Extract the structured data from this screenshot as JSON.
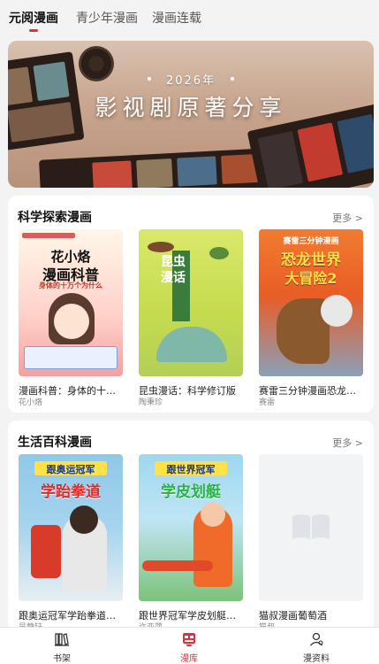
{
  "tabs": [
    {
      "label": "元阅漫画",
      "active": true
    },
    {
      "label": "青少年漫画",
      "active": false
    },
    {
      "label": "漫画连载",
      "active": false
    }
  ],
  "banner": {
    "year": "2026年",
    "title": "影视剧原著分享"
  },
  "sections": [
    {
      "title": "科学探索漫画",
      "more": "更多 >",
      "books": [
        {
          "title": "漫画科普：身体的十万个为什么",
          "author": "花小烙",
          "cover_heading": "花小烙",
          "cover_line1": "漫画科普",
          "cover_line2": "身体的十万个为什么"
        },
        {
          "title": "昆虫漫话：科学修订版",
          "author": "陶秉珍",
          "cover_heading": "昆虫漫话"
        },
        {
          "title": "赛雷三分钟漫画恐龙世界大冒险",
          "author": "赛雷",
          "cover_heading": "赛雷三分钟漫画",
          "cover_line1": "恐龙世界",
          "cover_line2": "大冒险2"
        }
      ]
    },
    {
      "title": "生活百科漫画",
      "more": "更多 >",
      "books": [
        {
          "title": "跟奥运冠军学跆拳道（漫画版）",
          "author": "吴静钰",
          "cover_heading": "跟奥运冠军",
          "cover_line1": "学跆拳道"
        },
        {
          "title": "跟世界冠军学皮划艇（漫画版）",
          "author": "许亚萍",
          "cover_heading": "跟世界冠军",
          "cover_line1": "学皮划艇"
        },
        {
          "title": "猫叔漫画葡萄酒",
          "author": "猫叔"
        }
      ]
    }
  ],
  "bottom_nav": [
    {
      "label": "书架",
      "icon": "bookshelf-icon",
      "active": false
    },
    {
      "label": "漫库",
      "icon": "comic-library-icon",
      "active": true
    },
    {
      "label": "漫资料",
      "icon": "profile-icon",
      "active": false
    }
  ],
  "colors": {
    "accent": "#e0303b",
    "background": "#f3f3f3"
  }
}
